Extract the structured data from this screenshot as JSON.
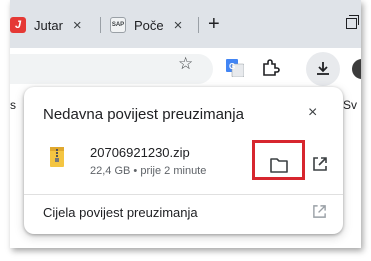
{
  "tabs": [
    {
      "favicon": "J",
      "label": "Jutar",
      "close": "×"
    },
    {
      "favicon": "SAP",
      "label": "Poče",
      "close": "×"
    }
  ],
  "new_tab": "+",
  "bookmarks": {
    "left_fragment": "s",
    "right_fragment": "Sv"
  },
  "download_bubble": {
    "title": "Nedavna povijest preuzimanja",
    "close": "×",
    "item": {
      "file_name": "20706921230.zip",
      "meta": "22,4 GB • prije 2 minute"
    },
    "full_history_label": "Cijela povijest preuzimanja"
  },
  "colors": {
    "highlight": "#d7262e",
    "tabstrip": "#dfe3e8",
    "zip_folder": "#f4c542"
  }
}
